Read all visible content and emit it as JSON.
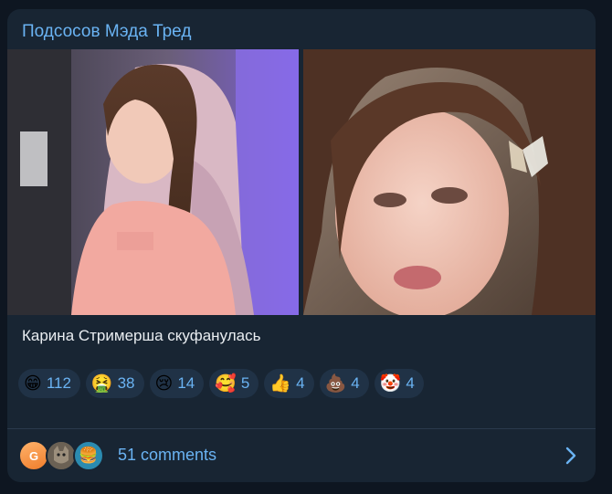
{
  "post": {
    "channel_title": "Подсосов Мэда Тред",
    "caption": "Карина Стримерша скуфанулась"
  },
  "media": {
    "left_photo": "photo",
    "right_photo": "photo"
  },
  "reactions": [
    {
      "emoji": "😁",
      "count": "112"
    },
    {
      "emoji": "🤮",
      "count": "38"
    },
    {
      "emoji": "😢",
      "count": "14"
    },
    {
      "emoji": "🥰",
      "count": "5"
    },
    {
      "emoji": "👍",
      "count": "4"
    },
    {
      "emoji": "💩",
      "count": "4"
    },
    {
      "emoji": "🤡",
      "count": "4"
    }
  ],
  "comments": {
    "label": "51 comments",
    "avatars": [
      {
        "letter": "G",
        "kind": "letter-avatar"
      },
      {
        "kind": "cat-photo-avatar"
      },
      {
        "kind": "burger-avatar",
        "emoji": "🍔"
      }
    ]
  },
  "colors": {
    "background": "#0e1621",
    "bubble": "#182533",
    "accent": "#6ab3f3",
    "reaction_bg": "#203246",
    "text": "#e9edf1"
  }
}
